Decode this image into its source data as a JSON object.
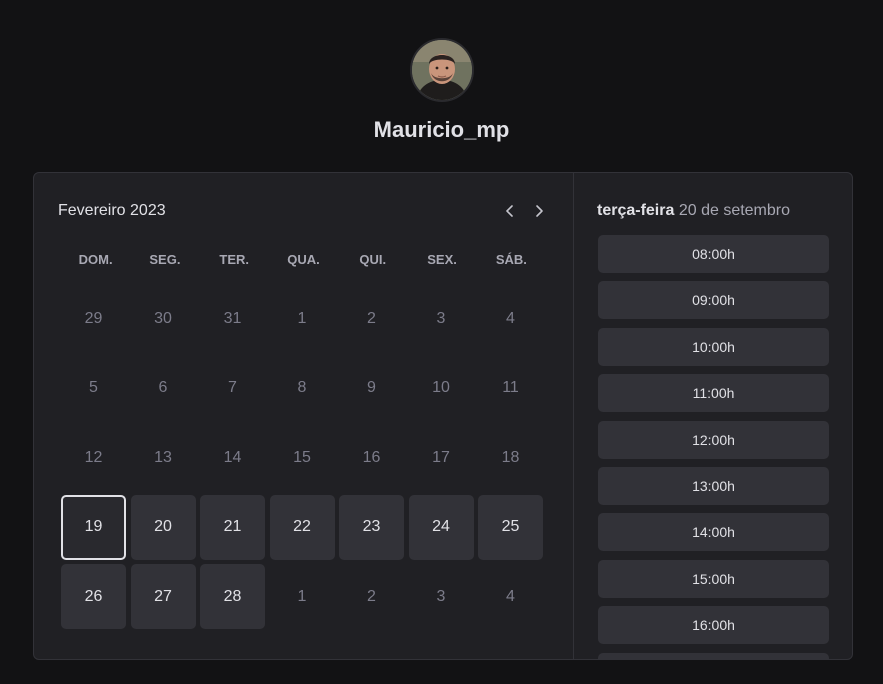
{
  "profile": {
    "username": "Mauricio_mp"
  },
  "calendar": {
    "month_title": "Fevereiro 2023",
    "weekdays": [
      "DOM.",
      "SEG.",
      "TER.",
      "QUA.",
      "QUI.",
      "SEX.",
      "SÁB."
    ],
    "days": [
      {
        "label": "29",
        "state": "disabled"
      },
      {
        "label": "30",
        "state": "disabled"
      },
      {
        "label": "31",
        "state": "disabled"
      },
      {
        "label": "1",
        "state": "disabled"
      },
      {
        "label": "2",
        "state": "disabled"
      },
      {
        "label": "3",
        "state": "disabled"
      },
      {
        "label": "4",
        "state": "disabled"
      },
      {
        "label": "5",
        "state": "disabled"
      },
      {
        "label": "6",
        "state": "disabled"
      },
      {
        "label": "7",
        "state": "disabled"
      },
      {
        "label": "8",
        "state": "disabled"
      },
      {
        "label": "9",
        "state": "disabled"
      },
      {
        "label": "10",
        "state": "disabled"
      },
      {
        "label": "11",
        "state": "disabled"
      },
      {
        "label": "12",
        "state": "disabled"
      },
      {
        "label": "13",
        "state": "disabled"
      },
      {
        "label": "14",
        "state": "disabled"
      },
      {
        "label": "15",
        "state": "disabled"
      },
      {
        "label": "16",
        "state": "disabled"
      },
      {
        "label": "17",
        "state": "disabled"
      },
      {
        "label": "18",
        "state": "disabled"
      },
      {
        "label": "19",
        "state": "selected"
      },
      {
        "label": "20",
        "state": "available"
      },
      {
        "label": "21",
        "state": "available"
      },
      {
        "label": "22",
        "state": "available"
      },
      {
        "label": "23",
        "state": "available"
      },
      {
        "label": "24",
        "state": "available"
      },
      {
        "label": "25",
        "state": "available"
      },
      {
        "label": "26",
        "state": "available"
      },
      {
        "label": "27",
        "state": "available"
      },
      {
        "label": "28",
        "state": "available"
      },
      {
        "label": "1",
        "state": "disabled"
      },
      {
        "label": "2",
        "state": "disabled"
      },
      {
        "label": "3",
        "state": "disabled"
      },
      {
        "label": "4",
        "state": "disabled"
      }
    ],
    "icons": {
      "prev": "chevron-left-icon",
      "next": "chevron-right-icon"
    }
  },
  "timepicker": {
    "weekday": "terça-feira",
    "date": "20 de setembro",
    "times": [
      "08:00h",
      "09:00h",
      "10:00h",
      "11:00h",
      "12:00h",
      "13:00h",
      "14:00h",
      "15:00h",
      "16:00h",
      ""
    ]
  },
  "colors": {
    "background": "#121214",
    "card": "#202024",
    "available_day": "#323238",
    "text": "#e1e1e6",
    "muted_text": "#7c7c8a"
  }
}
